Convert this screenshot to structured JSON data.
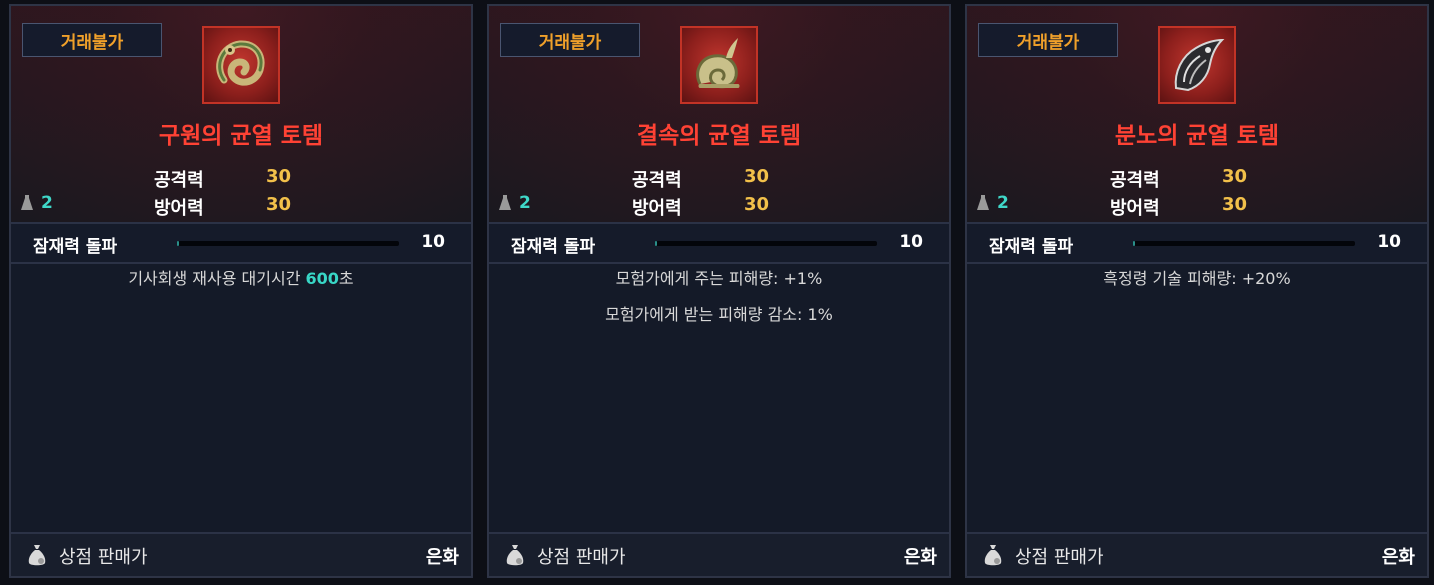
{
  "cards": [
    {
      "badge": "거래불가",
      "icon": "redemption-totem-icon",
      "name": "구원의 균열 토템",
      "stats": [
        {
          "label": "공격력",
          "value": "30"
        },
        {
          "label": "방어력",
          "value": "30"
        }
      ],
      "count": "2",
      "potential": {
        "label": "잠재력 돌파",
        "value": "10",
        "fill": 0.01
      },
      "effects": [
        {
          "text": "기사회생 재사용 대기시간 ",
          "highlight": "600",
          "suffix": "초"
        }
      ],
      "footer": {
        "label": "상점 판매가",
        "currency": "은화"
      }
    },
    {
      "badge": "거래불가",
      "icon": "binding-totem-icon",
      "name": "결속의 균열 토템",
      "stats": [
        {
          "label": "공격력",
          "value": "30"
        },
        {
          "label": "방어력",
          "value": "30"
        }
      ],
      "count": "2",
      "potential": {
        "label": "잠재력 돌파",
        "value": "10",
        "fill": 0.01
      },
      "effects": [
        {
          "text": "모험가에게 주는 피해량: +1%"
        },
        {
          "text": "모험가에게 받는 피해량 감소: 1%"
        }
      ],
      "footer": {
        "label": "상점 판매가",
        "currency": "은화"
      }
    },
    {
      "badge": "거래불가",
      "icon": "wrath-totem-icon",
      "name": "분노의 균열 토템",
      "stats": [
        {
          "label": "공격력",
          "value": "30"
        },
        {
          "label": "방어력",
          "value": "30"
        }
      ],
      "count": "2",
      "potential": {
        "label": "잠재력 돌파",
        "value": "10",
        "fill": 0.01
      },
      "effects": [
        {
          "text": "흑정령 기술 피해량: +20%"
        }
      ],
      "footer": {
        "label": "상점 판매가",
        "currency": "은화"
      }
    }
  ]
}
